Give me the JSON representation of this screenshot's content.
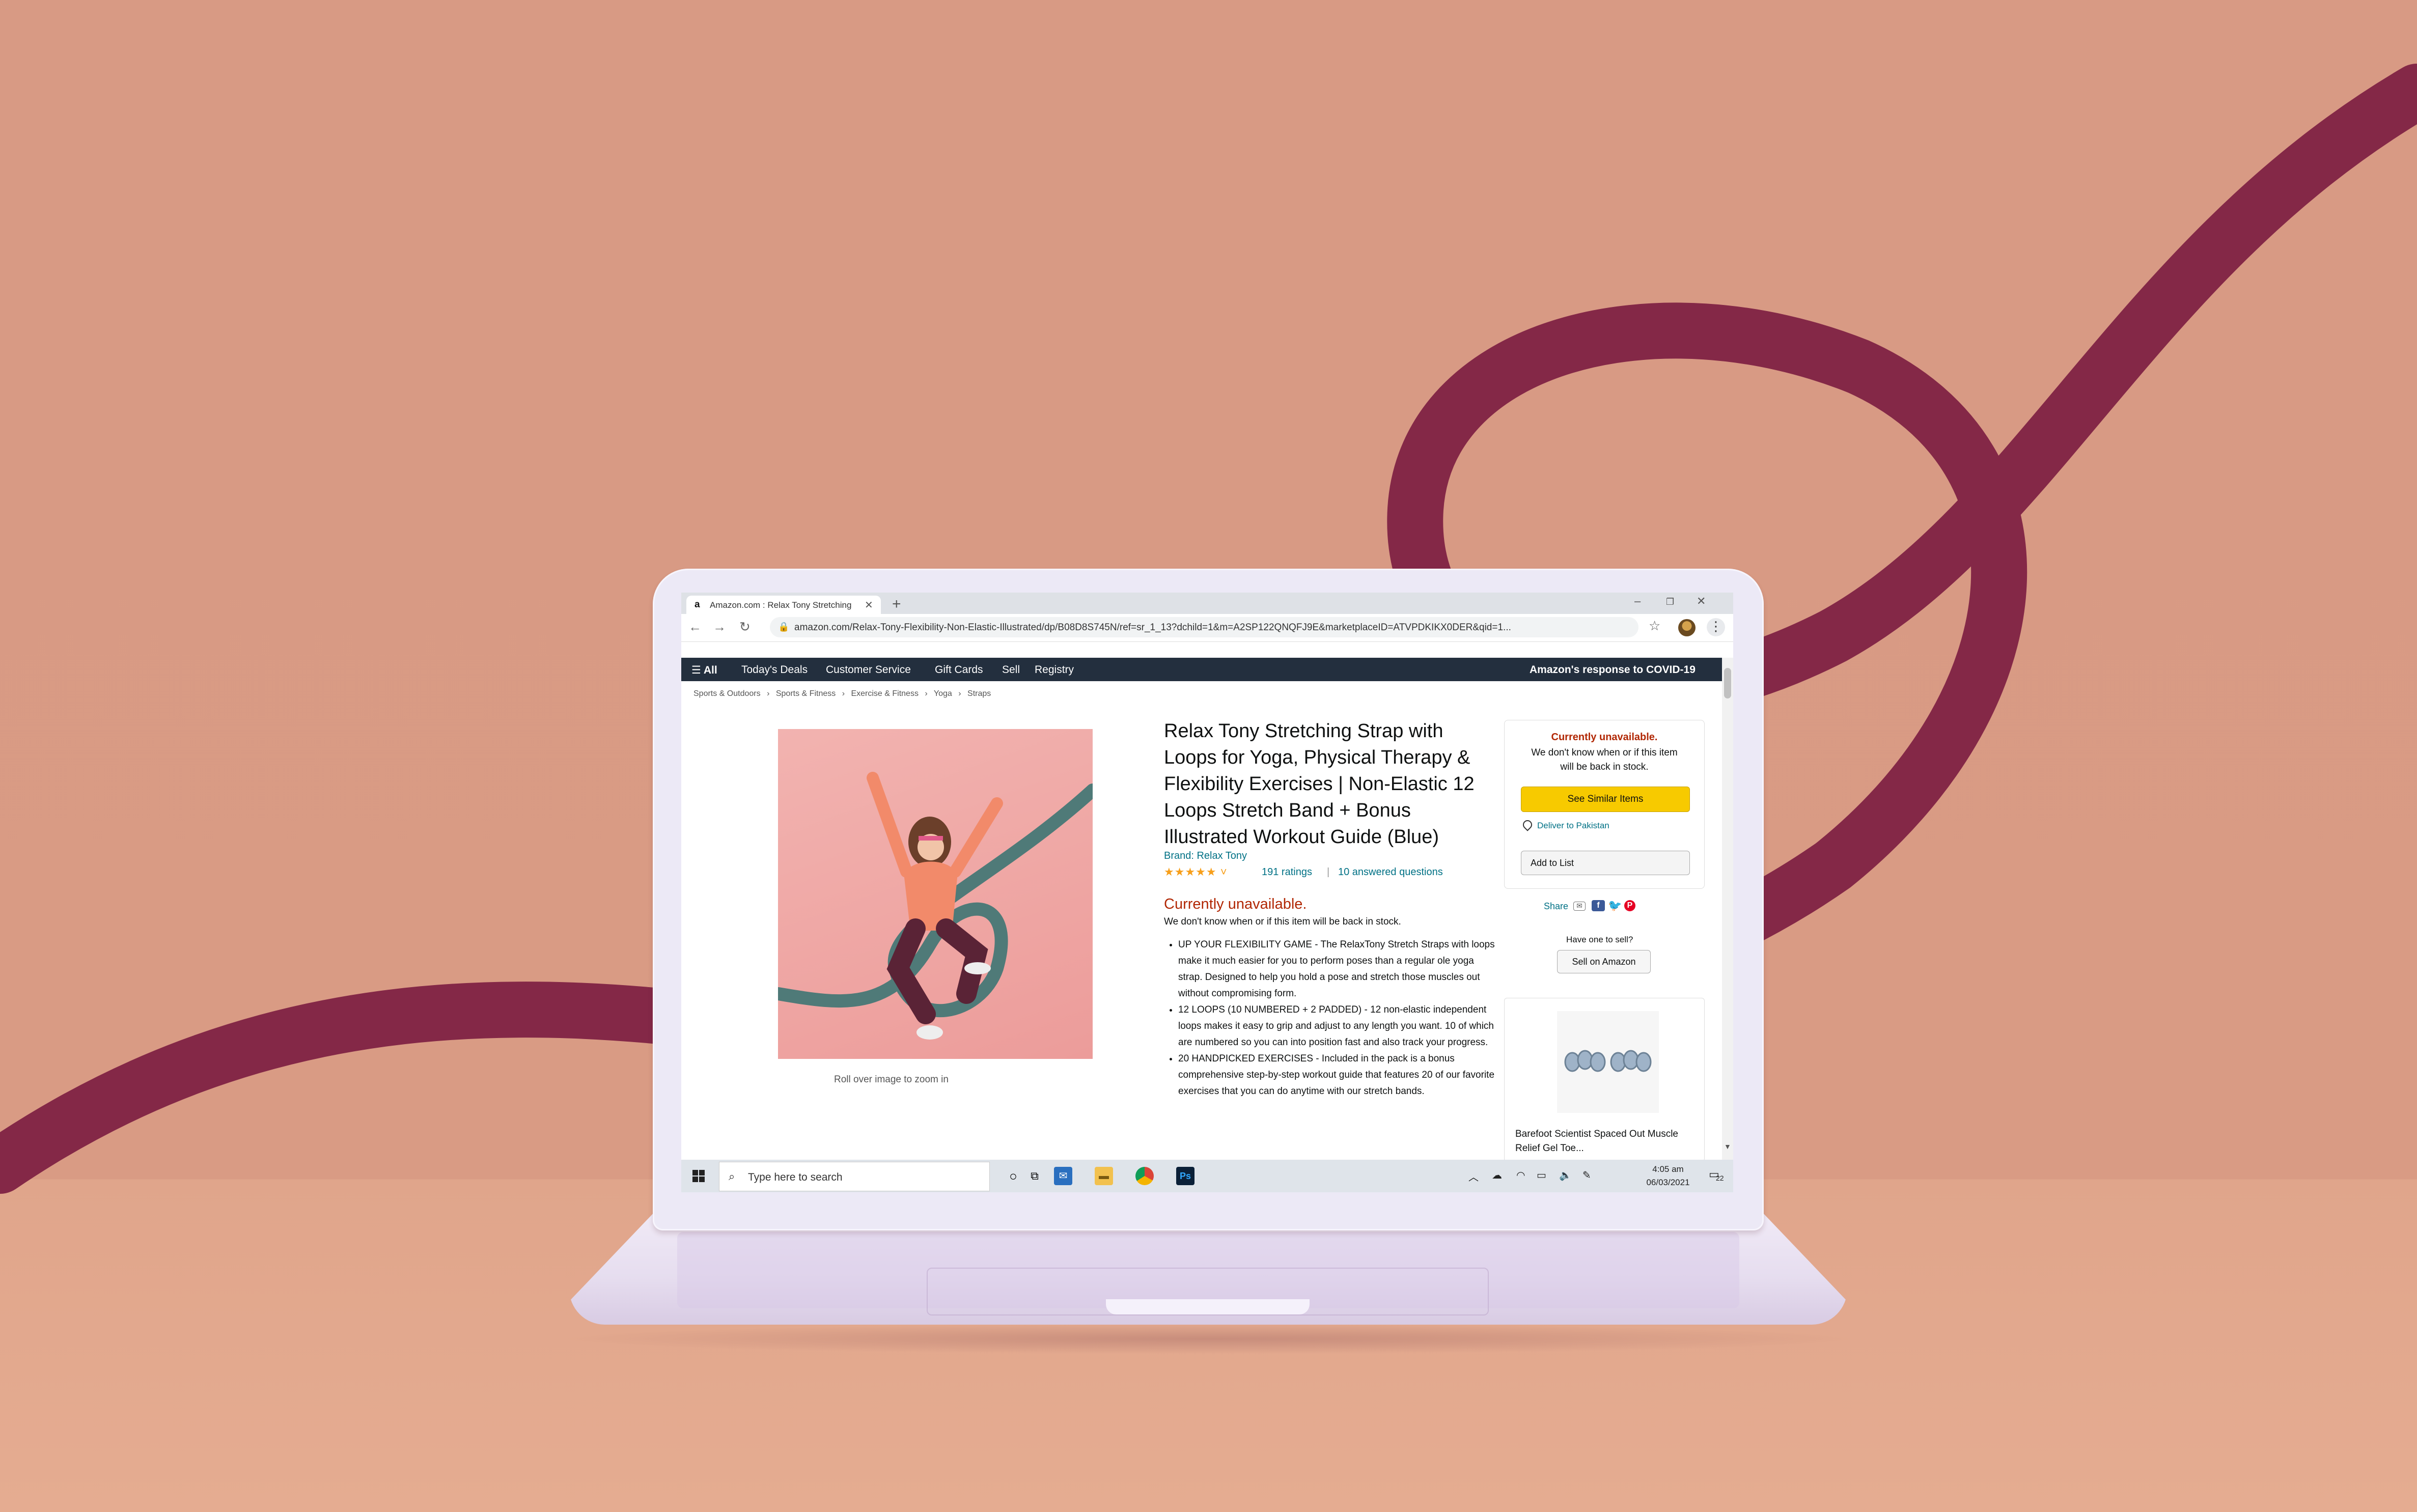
{
  "browser": {
    "tab_title": "Amazon.com : Relax Tony Stretching Strap",
    "tab_favicon": "a",
    "url": "amazon.com/Relax-Tony-Flexibility-Non-Elastic-Illustrated/dp/B08D8S745N/ref=sr_1_13?dchild=1&m=A2SP122QNQFJ9E&marketplaceID=ATVPDKIKX0DER&qid=1..."
  },
  "amazon_nav": {
    "all": "☰ All",
    "items": [
      "Today's Deals",
      "Customer Service",
      "Gift Cards",
      "Sell",
      "Registry"
    ],
    "covid": "Amazon's response to COVID-19"
  },
  "breadcrumbs": [
    "Sports & Outdoors",
    "›",
    "Sports & Fitness",
    "›",
    "Exercise & Fitness",
    "›",
    "Yoga",
    "›",
    "Straps"
  ],
  "product": {
    "title": "Relax Tony Stretching Strap with Loops for Yoga, Physical Therapy & Flexibility Exercises | Non-Elastic 12 Loops Stretch Band + Bonus Illustrated Workout Guide (Blue)",
    "brand": "Brand: Relax Tony",
    "stars_text": "★★★★★ ˅",
    "ratings": "191 ratings",
    "separator": "|",
    "answered": "10 answered questions",
    "unavailable": "Currently unavailable.",
    "unavailable_sub": "We don't know when or if this item will be back in stock.",
    "bullets": [
      "UP YOUR FLEXIBILITY GAME - The RelaxTony Stretch Straps with loops make it much easier for you to perform poses than a regular ole yoga strap. Designed to help you hold a pose and stretch those muscles out without compromising form.",
      "12 LOOPS (10 NUMBERED + 2 PADDED) - 12 non-elastic independent loops makes it easy to grip and adjust to any length you want. 10 of which are numbered so you can into position fast and also track your progress.",
      "20 HANDPICKED EXERCISES - Included in the pack is a bonus comprehensive step-by-step workout guide that features 20 of our favorite exercises that you can do anytime with our stretch bands."
    ],
    "zoom_hint": "Roll over image to zoom in"
  },
  "buybox": {
    "unavailable": "Currently unavailable.",
    "sub": "We don't know when or if this item will be back in stock.",
    "similar_button": "See Similar Items",
    "deliver": "Deliver to Pakistan",
    "add_to_list": "Add to List",
    "share": "Share",
    "have_one": "Have one to sell?",
    "sell_button": "Sell on Amazon"
  },
  "ad": {
    "title": "Barefoot Scientist Spaced Out Muscle Relief Gel Toe..."
  },
  "taskbar": {
    "search_placeholder": "Type here to search",
    "time": "4:05 am",
    "date": "06/03/2021",
    "notifications": "22"
  },
  "colors": {
    "background": "#d89a84",
    "ribbon": "#842847",
    "amazon_nav": "#232f3e",
    "link": "#007185",
    "unavailable": "#b12704",
    "button_yellow": "#f7ca00"
  }
}
